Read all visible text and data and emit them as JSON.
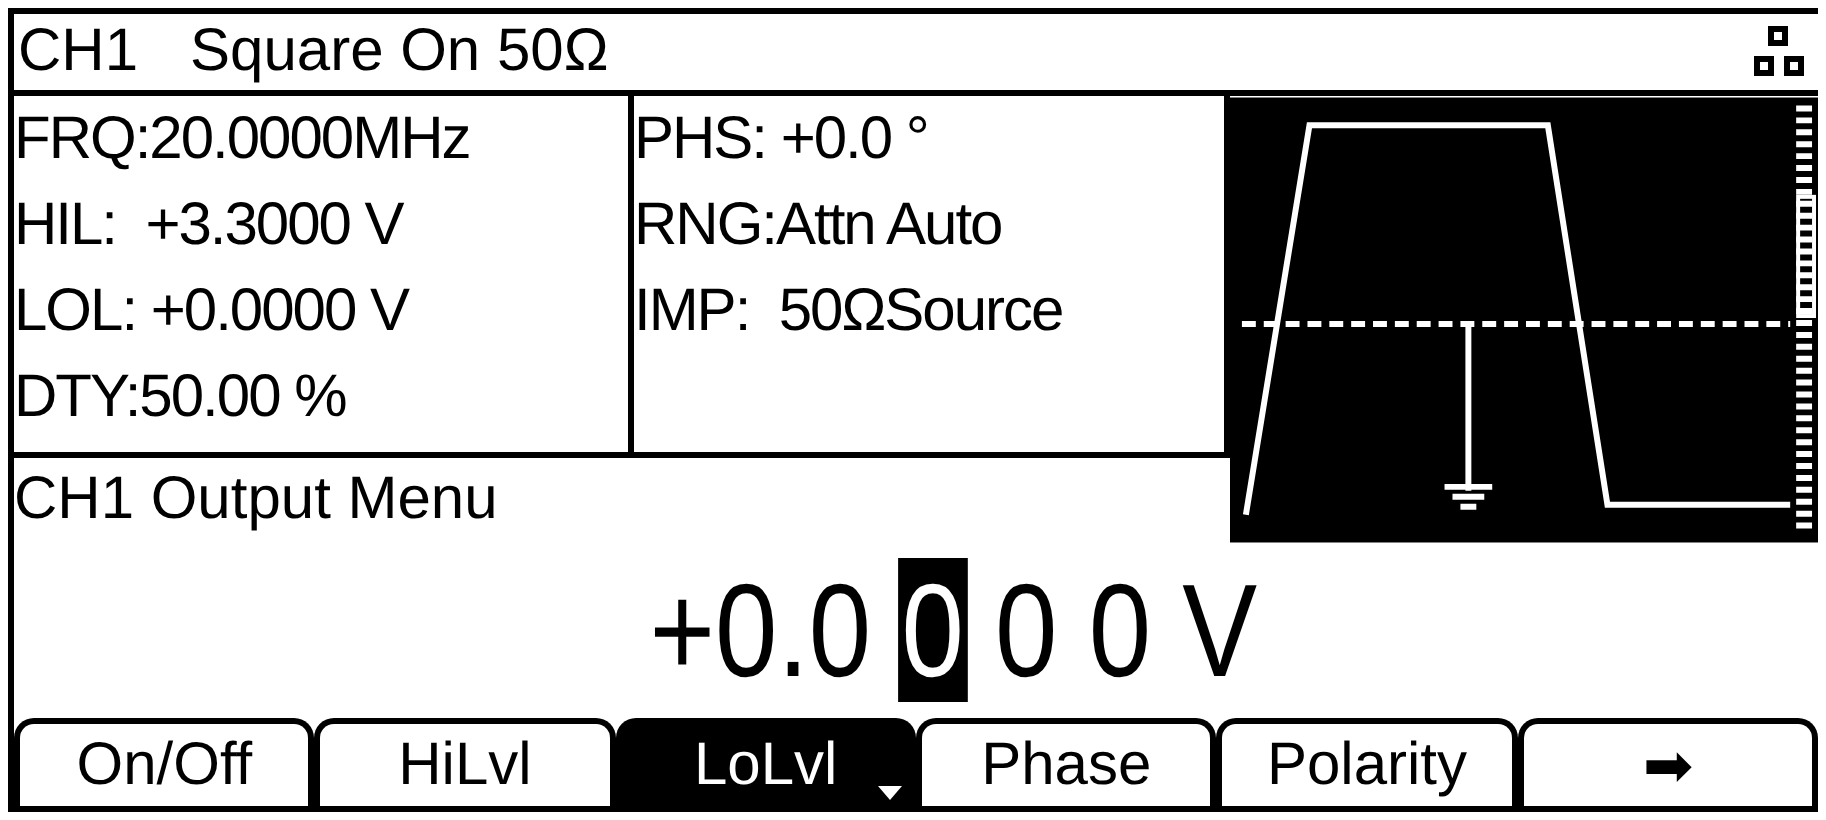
{
  "header": {
    "channel": "CH1",
    "status": "Square On 50Ω"
  },
  "params_left": [
    "FRQ:20.0000MHz",
    "HIL:  +3.3000 V",
    "LOL: +0.0000 V",
    "DTY:50.00 %"
  ],
  "params_right": [
    "PHS: +0.0 °",
    "RNG:Attn Auto",
    "IMP:  50ΩSource"
  ],
  "menu_title": "CH1 Output Menu",
  "value_parts": [
    {
      "text": "+0.0",
      "selected": false
    },
    {
      "text": "0",
      "selected": true
    },
    {
      "text": "0 0 V",
      "selected": false
    }
  ],
  "softkeys": [
    {
      "label": "On/Off",
      "selected": false
    },
    {
      "label": "HiLvl",
      "selected": false
    },
    {
      "label": "LoLvl",
      "selected": true
    },
    {
      "label": "Phase",
      "selected": false
    },
    {
      "label": "Polarity",
      "selected": false
    },
    {
      "label": "➡",
      "selected": false
    }
  ]
}
